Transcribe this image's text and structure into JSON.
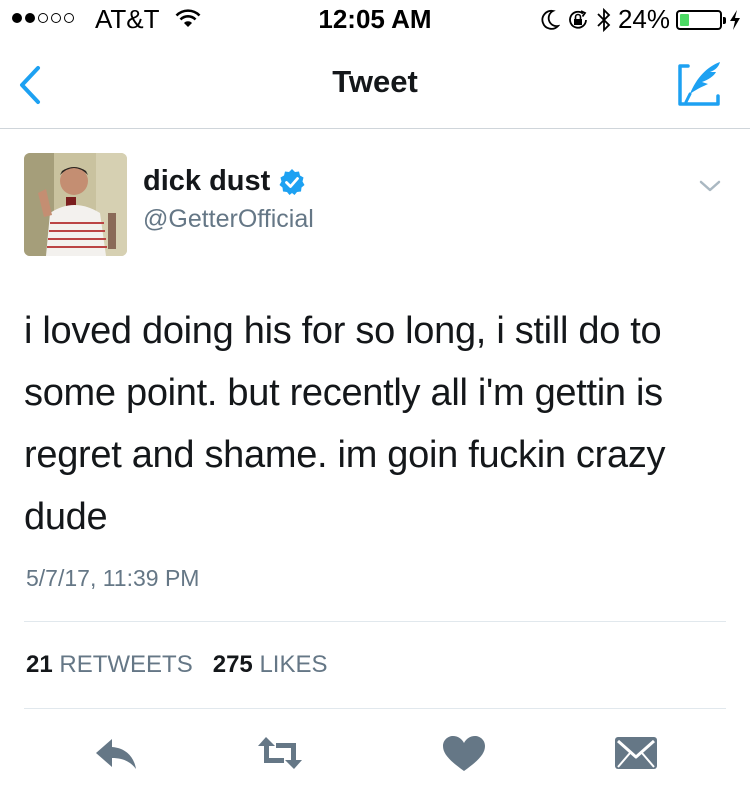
{
  "status_bar": {
    "carrier": "AT&T",
    "time": "12:05 AM",
    "battery": "24%",
    "battery_level": 0.24,
    "signal_bars_filled": 2,
    "signal_bars_total": 5
  },
  "nav": {
    "title": "Tweet"
  },
  "tweet": {
    "display_name": "dick dust",
    "handle": "@GetterOfficial",
    "text": "i loved doing his for so long, i still do to some point. but recently all i'm gettin is regret and shame. im goin fuckin crazy dude",
    "timestamp": "5/7/17, 11:39 PM",
    "retweets_count": "21",
    "retweets_label": "RETWEETS",
    "likes_count": "275",
    "likes_label": "LIKES"
  },
  "colors": {
    "accent": "#1da1f2",
    "icon_gray": "#657786",
    "divider": "#e1e8ed",
    "battery_green": "#4cd964"
  },
  "icons": [
    "back-chevron-icon",
    "compose-icon",
    "verified-badge-icon",
    "caret-down-icon",
    "reply-icon",
    "retweet-icon",
    "like-icon",
    "direct-message-icon",
    "wifi-icon",
    "moon-icon",
    "lock-rotation-icon",
    "bluetooth-icon",
    "charging-icon"
  ]
}
